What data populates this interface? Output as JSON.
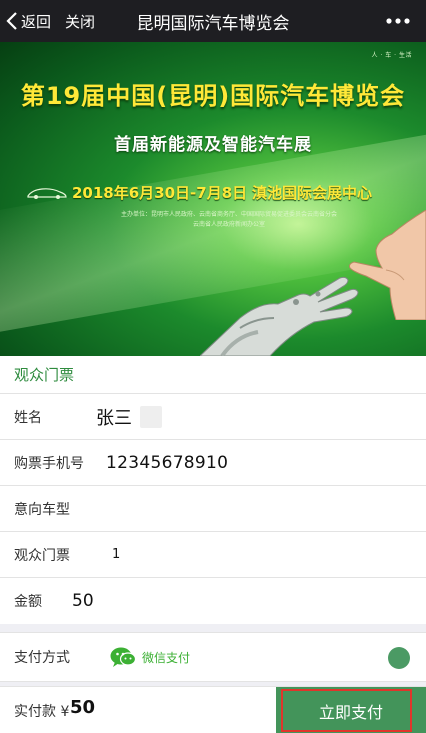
{
  "nav": {
    "back_label": "返回",
    "close_label": "关闭",
    "title": "昆明国际汽车博览会"
  },
  "banner": {
    "logo_text": "人 · 车 · 生活",
    "title": "第19届中国(昆明)国际汽车博览会",
    "subtitle": "首届新能源及智能汽车展",
    "date": "2018年6月30日-7月8日",
    "venue": "滇池国际会展中心",
    "host_line1": "主办单位：昆明市人民政府、云南省商务厅、中国国际贸易促进委员会云南省分会",
    "host_line2": "云南省人民政府新闻办公室"
  },
  "form": {
    "section_title": "观众门票",
    "name_label": "姓名",
    "name_value": "张三",
    "phone_label": "购票手机号",
    "phone_value": "12345678910",
    "model_label": "意向车型",
    "ticket_label": "观众门票",
    "ticket_value": "1",
    "amount_label": "金额",
    "amount_value": "50",
    "pay_label": "支付方式",
    "pay_method": "微信支付"
  },
  "footer": {
    "total_label": "实付款 ¥",
    "total_value": "50",
    "pay_button": "立即支付"
  },
  "colors": {
    "accent": "#2e8b3e",
    "pay_button": "#43945a",
    "wechat": "#3cb034",
    "highlight_border": "#e0352b"
  },
  "icons": {
    "back": "chevron-left-icon",
    "more": "more-dots-icon",
    "wechat": "wechat-pay-icon"
  }
}
